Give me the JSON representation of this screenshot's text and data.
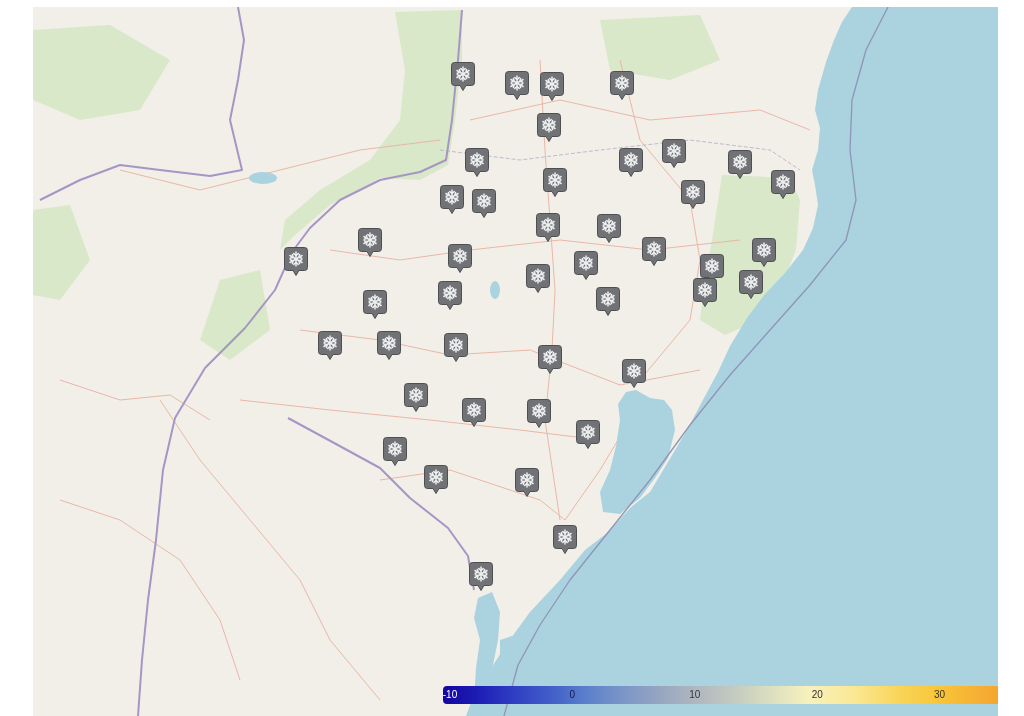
{
  "map": {
    "markers": [
      {
        "kind": "snowflake"
      },
      {
        "kind": "snowflake"
      },
      {
        "kind": "snowflake"
      },
      {
        "kind": "snowflake"
      },
      {
        "kind": "snowflake"
      },
      {
        "kind": "snowflake"
      },
      {
        "kind": "snowflake"
      },
      {
        "kind": "snowflake"
      },
      {
        "kind": "snowflake"
      },
      {
        "kind": "snowflake"
      },
      {
        "kind": "snowflake"
      },
      {
        "kind": "snowflake"
      },
      {
        "kind": "snowflake"
      },
      {
        "kind": "snowflake"
      },
      {
        "kind": "snowflake"
      },
      {
        "kind": "snowflake"
      },
      {
        "kind": "snowflake"
      },
      {
        "kind": "snowflake"
      },
      {
        "kind": "snowflake"
      },
      {
        "kind": "snowflake"
      },
      {
        "kind": "snowflake"
      },
      {
        "kind": "snowflake"
      },
      {
        "kind": "snowflake"
      },
      {
        "kind": "snowflake"
      },
      {
        "kind": "snowflake"
      },
      {
        "kind": "snowflake"
      },
      {
        "kind": "snowflake"
      },
      {
        "kind": "snowflake"
      },
      {
        "kind": "snowflake"
      },
      {
        "kind": "snowflake"
      },
      {
        "kind": "snowflake"
      },
      {
        "kind": "snowflake"
      },
      {
        "kind": "snowflake"
      },
      {
        "kind": "snowflake"
      },
      {
        "kind": "snowflake"
      },
      {
        "kind": "snowflake"
      },
      {
        "kind": "snowflake"
      },
      {
        "kind": "snowflake"
      },
      {
        "kind": "snowflake"
      },
      {
        "kind": "snowflake"
      },
      {
        "kind": "snowflake"
      },
      {
        "kind": "snowflake"
      },
      {
        "kind": "snowflake"
      }
    ]
  },
  "color_scale": {
    "ticks": [
      "-10",
      "0",
      "10",
      "20",
      "30"
    ]
  }
}
